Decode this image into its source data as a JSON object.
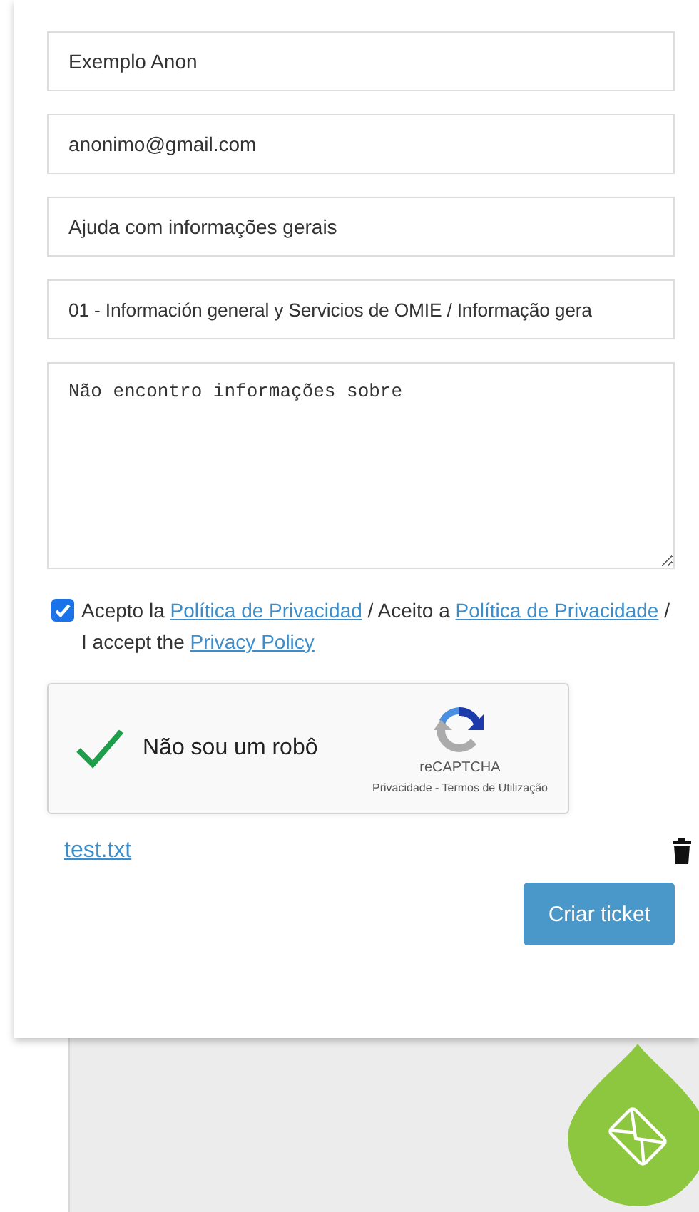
{
  "fields": [
    {
      "kind": "input",
      "value": "Exemplo Anon"
    },
    {
      "kind": "input",
      "value": "anonimo@gmail.com"
    },
    {
      "kind": "input",
      "value": "Ajuda com informações gerais"
    },
    {
      "kind": "select",
      "value": "01 - Información general y Servicios de OMIE / Informação gera"
    },
    {
      "kind": "textarea",
      "value": "Não encontro informações sobre"
    }
  ],
  "consent": {
    "checked": true,
    "parts": [
      {
        "kind": "text",
        "text": "Acepto la "
      },
      {
        "kind": "link",
        "text": "Política de Privacidad"
      },
      {
        "kind": "text",
        "text": " / Aceito a "
      },
      {
        "kind": "link",
        "text": "Política de Privacidade"
      },
      {
        "kind": "text",
        "text": " / I accept the "
      },
      {
        "kind": "link",
        "text": "Privacy Policy"
      }
    ]
  },
  "captcha": {
    "checked": true,
    "label": "Não sou um robô",
    "brand": "reCAPTCHA",
    "footer": "Privacidade - Termos de Utilização"
  },
  "attachment": {
    "name": "test.txt"
  },
  "submit": {
    "label": "Criar ticket"
  }
}
